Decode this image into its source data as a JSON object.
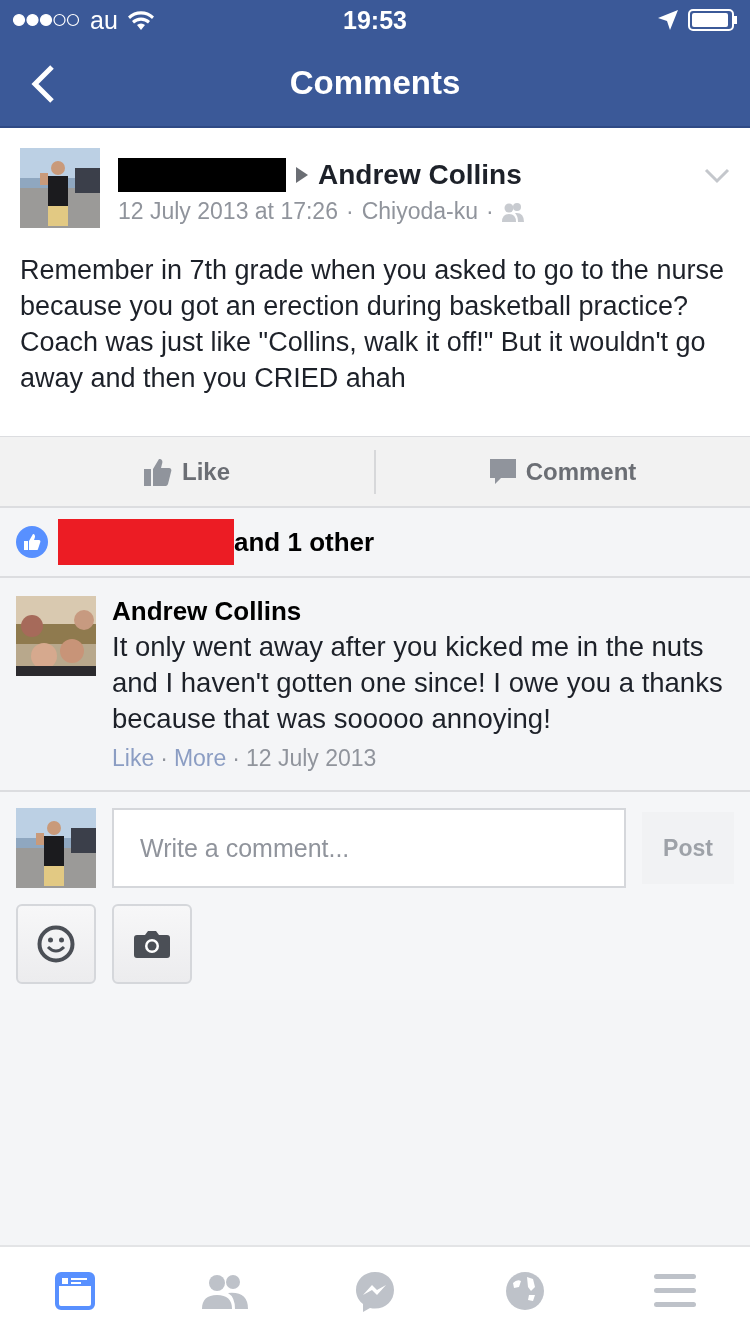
{
  "status_bar": {
    "carrier": "au",
    "time": "19:53"
  },
  "nav": {
    "title": "Comments"
  },
  "post": {
    "author": "Andrew Collins",
    "author_redacted": true,
    "meta_time": "12 July 2013 at 17:26",
    "meta_place": "Chiyoda-ku",
    "separators": [
      "·",
      "·"
    ],
    "text": "Remember in 7th grade when you asked to go to the nurse because you got an erection during basketball practice? Coach was just like \"Collins, walk it off!\" But it wouldn't go away and then you CRIED ahah"
  },
  "actions": [
    {
      "kind": "like",
      "label": "Like"
    },
    {
      "kind": "comment",
      "label": "Comment"
    }
  ],
  "likes": {
    "redacted": true,
    "text": "and 1 other"
  },
  "comments": [
    {
      "author": "Andrew Collins",
      "text": "It only went away after you kicked me in the nuts and I haven't gotten one since! I owe you a thanks because that was sooooo annoying!",
      "like": "Like",
      "more": "More",
      "separators": [
        "·",
        "·"
      ],
      "date": "12 July 2013"
    }
  ],
  "composer": {
    "placeholder": "Write a comment...",
    "post_button": "Post",
    "post_disabled": true
  },
  "tab_bar": [
    {
      "kind": "feed",
      "selected": true
    },
    {
      "kind": "friends",
      "selected": false
    },
    {
      "kind": "messenger",
      "selected": false
    },
    {
      "kind": "globe",
      "selected": false
    },
    {
      "kind": "menu",
      "selected": false
    }
  ]
}
